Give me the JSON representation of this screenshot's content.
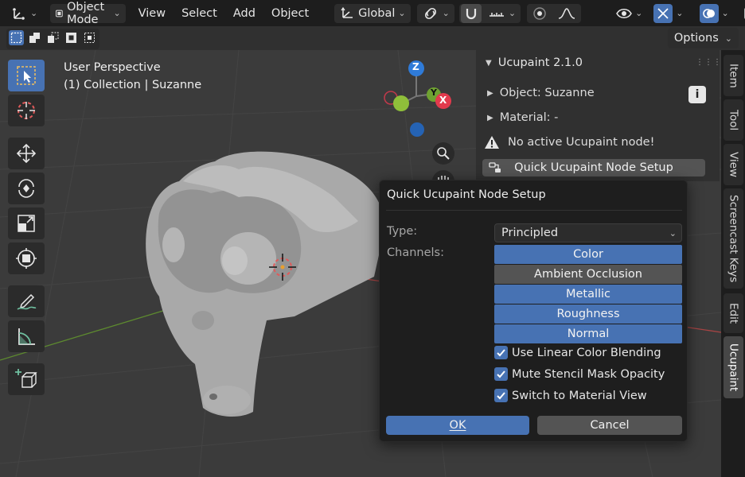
{
  "header": {
    "mode_label": "Object Mode",
    "menus": [
      "View",
      "Select",
      "Add",
      "Object"
    ],
    "transform_orientation": "Global"
  },
  "toolbar2": {
    "options_label": "Options"
  },
  "viewport": {
    "perspective": "User Perspective",
    "collection_line": "(1) Collection | Suzanne",
    "gizmo": {
      "x": "X",
      "y": "Y",
      "z": "Z"
    },
    "tools": [
      "select-box",
      "cursor",
      "move",
      "rotate",
      "scale",
      "transform",
      "annotate",
      "measure",
      "add-cube"
    ]
  },
  "npanel": {
    "title": "Ucupaint 2.1.0",
    "object_row": "Object: Suzanne",
    "material_row": "Material: -",
    "warning": "No active Ucupaint node!",
    "quick_button": "Quick Ucupaint Node Setup"
  },
  "side_tabs": [
    "Item",
    "Tool",
    "View",
    "Screencast Keys",
    "Edit",
    "Ucupaint"
  ],
  "dialog": {
    "title": "Quick Ucupaint Node Setup",
    "type_label": "Type:",
    "type_value": "Principled",
    "channels_label": "Channels:",
    "channels": [
      {
        "label": "Color",
        "enabled": true
      },
      {
        "label": "Ambient Occlusion",
        "enabled": false
      },
      {
        "label": "Metallic",
        "enabled": true
      },
      {
        "label": "Roughness",
        "enabled": true
      },
      {
        "label": "Normal",
        "enabled": true
      }
    ],
    "checkboxes": [
      {
        "label": "Use Linear Color Blending",
        "checked": true
      },
      {
        "label": "Mute Stencil Mask Opacity",
        "checked": true
      },
      {
        "label": "Switch to Material View",
        "checked": true
      }
    ],
    "ok_label": "OK",
    "cancel_label": "Cancel"
  },
  "colors": {
    "accent": "#4772b3",
    "header_bg": "#1d1d1d",
    "viewport_bg": "#3b3b3b",
    "dialog_bg": "#1e1e1e",
    "gizmo_x": "#e23a4d",
    "gizmo_y": "#6fa231",
    "gizmo_z": "#2f7bd8"
  }
}
